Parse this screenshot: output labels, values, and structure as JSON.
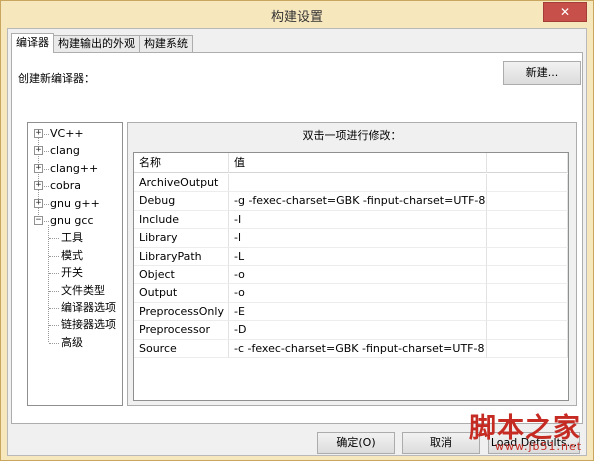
{
  "window": {
    "title": "构建设置",
    "close_label": "✕"
  },
  "tabs": [
    {
      "label": "编译器"
    },
    {
      "label": "构建输出的外观"
    },
    {
      "label": "构建系统"
    }
  ],
  "compiler": {
    "create_label": "创建新编译器：",
    "new_button": "新建..."
  },
  "tree": {
    "compilers": [
      {
        "label": "VC++",
        "expander": "+"
      },
      {
        "label": "clang",
        "expander": "+"
      },
      {
        "label": "clang++",
        "expander": "+"
      },
      {
        "label": "cobra",
        "expander": "+"
      },
      {
        "label": "gnu g++",
        "expander": "+"
      },
      {
        "label": "gnu gcc",
        "expander": "−"
      }
    ],
    "children": [
      {
        "label": "工具"
      },
      {
        "label": "模式"
      },
      {
        "label": "开关"
      },
      {
        "label": "文件类型"
      },
      {
        "label": "编译器选项"
      },
      {
        "label": "链接器选项"
      },
      {
        "label": "高级"
      }
    ]
  },
  "grid": {
    "hint": "双击一项进行修改：",
    "columns": {
      "name": "名称",
      "value": "值",
      "extra": ""
    },
    "rows": [
      {
        "name": "ArchiveOutput",
        "value": ""
      },
      {
        "name": "Debug",
        "value": "-g -fexec-charset=GBK -finput-charset=UTF-8"
      },
      {
        "name": "Include",
        "value": "-I"
      },
      {
        "name": "Library",
        "value": "-l"
      },
      {
        "name": "LibraryPath",
        "value": "-L"
      },
      {
        "name": "Object",
        "value": "-o"
      },
      {
        "name": "Output",
        "value": "-o"
      },
      {
        "name": "PreprocessOnly",
        "value": "-E"
      },
      {
        "name": "Preprocessor",
        "value": "-D"
      },
      {
        "name": "Source",
        "value": "-c -fexec-charset=GBK -finput-charset=UTF-8"
      }
    ]
  },
  "footer": {
    "ok": "确定(O)",
    "cancel": "取消",
    "defaults": "Load Defaults..."
  },
  "watermark": {
    "main": "脚本之家",
    "url": "www.jb51.net"
  },
  "colors": {
    "frame": "#f7e7bd",
    "close": "#c7504b",
    "watermark": "#c62b23"
  }
}
